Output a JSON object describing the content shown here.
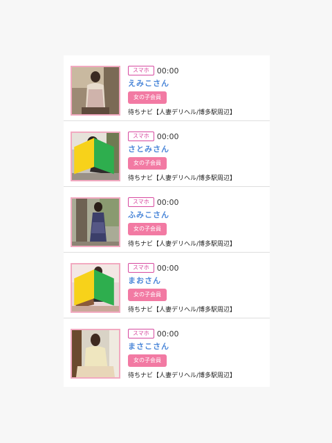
{
  "list": {
    "items": [
      {
        "device": "スマホ",
        "time": "00:00",
        "name": "えみこさん",
        "member": "女の子会員",
        "shop": "待ちナビ【人妻デリヘル/博多駅周辺】",
        "beginner": false
      },
      {
        "device": "スマホ",
        "time": "00:00",
        "name": "さとみさん",
        "member": "女の子会員",
        "shop": "待ちナビ【人妻デリヘル/博多駅周辺】",
        "beginner": true
      },
      {
        "device": "スマホ",
        "time": "00:00",
        "name": "ふみこさん",
        "member": "女の子会員",
        "shop": "待ちナビ【人妻デリヘル/博多駅周辺】",
        "beginner": false
      },
      {
        "device": "スマホ",
        "time": "00:00",
        "name": "まおさん",
        "member": "女の子会員",
        "shop": "待ちナビ【人妻デリヘル/博多駅周辺】",
        "beginner": true
      },
      {
        "device": "スマホ",
        "time": "00:00",
        "name": "まさこさん",
        "member": "女の子会員",
        "shop": "待ちナビ【人妻デリヘル/博多駅周辺】",
        "beginner": false
      }
    ]
  },
  "colors": {
    "device_badge": "#d6479e",
    "name_text": "#4a86d8",
    "member_badge": "#f27aa3",
    "thumb_border": "#f2a9c0"
  }
}
